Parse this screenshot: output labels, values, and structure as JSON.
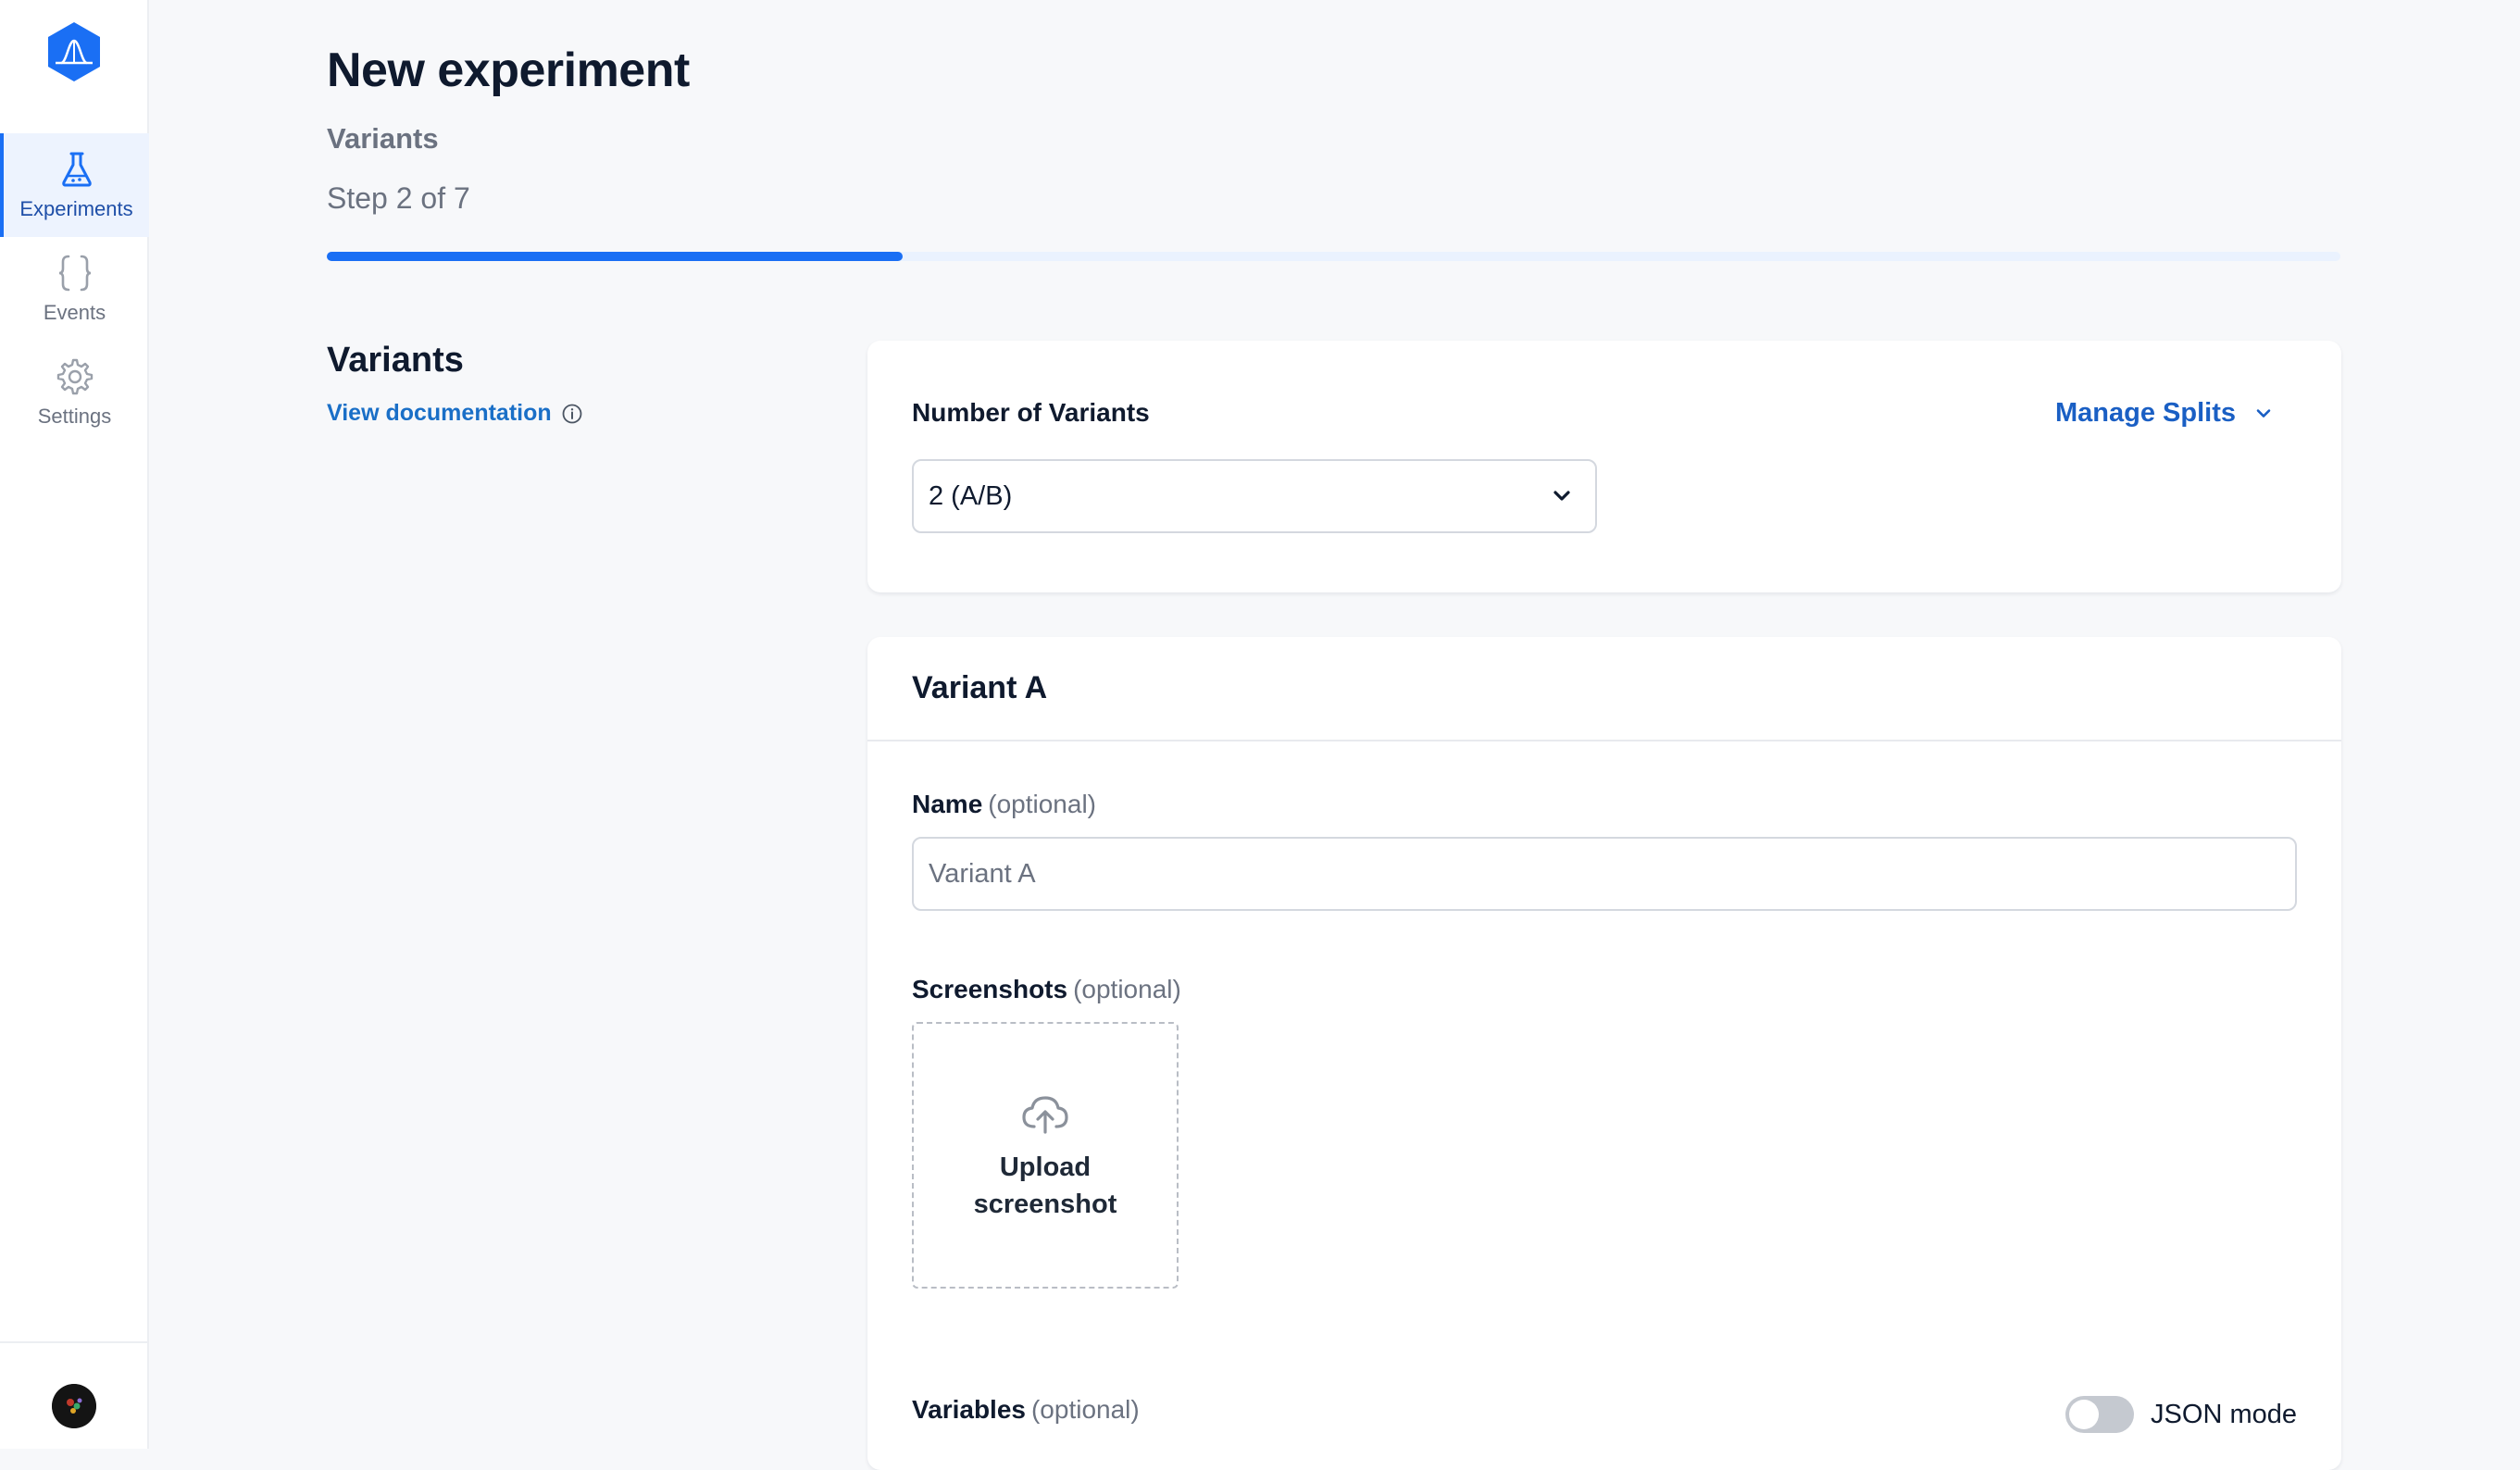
{
  "sidebar": {
    "items": [
      {
        "label": "Experiments",
        "icon": "flask-icon",
        "active": true
      },
      {
        "label": "Events",
        "icon": "braces-icon",
        "active": false
      },
      {
        "label": "Settings",
        "icon": "gear-icon",
        "active": false
      }
    ]
  },
  "header": {
    "title": "New experiment",
    "step_name": "Variants",
    "step_count": "Step 2 of 7",
    "progress": 0.286
  },
  "section": {
    "title": "Variants",
    "doc_link": "View documentation"
  },
  "variants_card": {
    "label": "Number of Variants",
    "selected": "2 (A/B)",
    "manage_splits": "Manage Splits"
  },
  "variant_a": {
    "title": "Variant A",
    "name_label": "Name",
    "name_optional": "(optional)",
    "name_placeholder": "Variant A",
    "screenshots_label": "Screenshots",
    "screenshots_optional": "(optional)",
    "upload_line1": "Upload",
    "upload_line2": "screenshot",
    "variables_label": "Variables",
    "variables_optional": "(optional)",
    "json_mode_label": "JSON mode",
    "json_mode_on": false
  },
  "colors": {
    "accent": "#1a6ff4",
    "link": "#1a5fc4"
  }
}
